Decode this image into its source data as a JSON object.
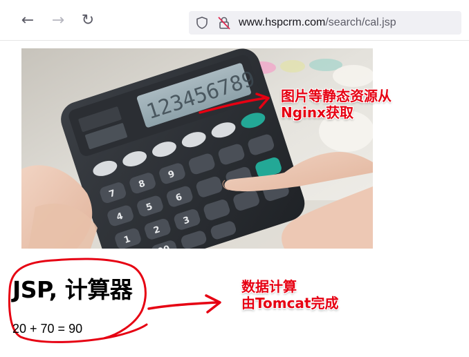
{
  "browser": {
    "nav": {
      "back_icon": "arrow-left-icon",
      "forward_icon": "arrow-right-icon",
      "reload_icon": "reload-icon",
      "back_glyph": "←",
      "forward_glyph": "→",
      "reload_glyph": "↻"
    },
    "url": {
      "host": "www.hspcrm.com",
      "path": "/search/cal.jsp"
    },
    "shield_icon": "tracking-protection-shield-icon",
    "lock_icon": "insecure-lock-icon"
  },
  "page": {
    "image_subject": "calculator-photo",
    "heading": "JSP, 计算器",
    "result": "20 + 70 = 90"
  },
  "annotations": {
    "static_line1": "图片等静态资源从",
    "static_line2": "Nginx获取",
    "compute_line1": "数据计算",
    "compute_line2": "由Tomcat完成",
    "color": "#e60012"
  }
}
